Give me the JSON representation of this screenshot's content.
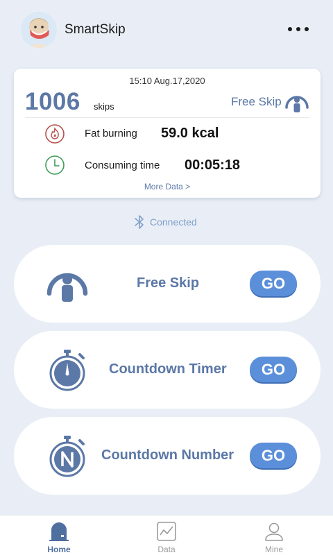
{
  "header": {
    "app_name": "SmartSkip",
    "avatar_alt": "avatar",
    "more_icon": "more-dots-icon"
  },
  "summary": {
    "datetime": "15:10 Aug.17,2020",
    "skip_count": "1006",
    "skip_unit": "skips",
    "mode_label": "Free Skip",
    "fat_label": "Fat burning",
    "fat_value": "59.0 kcal",
    "time_label": "Consuming time",
    "time_value": "00:05:18",
    "more_data": "More Data >"
  },
  "connection": {
    "status": "Connected",
    "icon": "bluetooth-icon"
  },
  "modes": [
    {
      "label": "Free Skip",
      "go": "GO",
      "icon": "free-skip-icon"
    },
    {
      "label": "Countdown Timer",
      "go": "GO",
      "icon": "stopwatch-icon"
    },
    {
      "label": "Countdown Number",
      "go": "GO",
      "icon": "stopwatch-number-icon"
    }
  ],
  "tabs": [
    {
      "label": "Home",
      "active": true
    },
    {
      "label": "Data",
      "active": false
    },
    {
      "label": "Mine",
      "active": false
    }
  ],
  "colors": {
    "background": "#e9eef6",
    "accent": "#5b78a6",
    "go_button": "#5b8fda",
    "fat_icon": "#b6504a",
    "time_icon": "#3f9b5a"
  }
}
